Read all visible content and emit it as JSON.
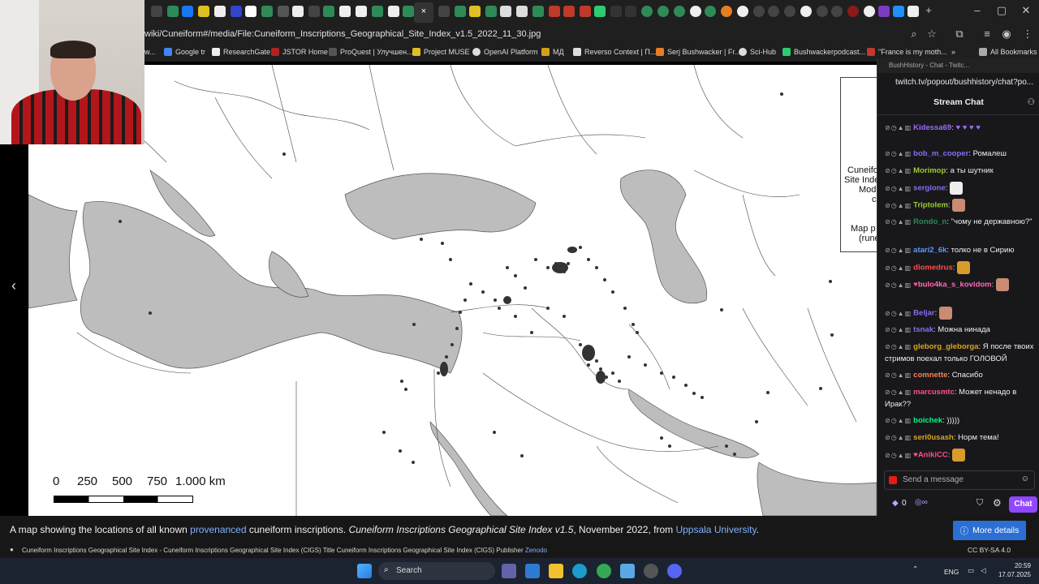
{
  "browser": {
    "url": "wiki/Cuneiform#/media/File:Cuneiform_Inscriptions_Geographical_Site_Index_v1.5_2022_11_30.jpg",
    "bookmarks": [
      "Google tr",
      "ResearchGate",
      "JSTOR Home",
      "ProQuest | Улучшен...",
      "Project MUSE",
      "OpenAI Platform",
      "МД",
      "Reverso Context | П...",
      "Serj Bushwacker | Fr...",
      "Sci-Hub",
      "Bushwackerpodcast...",
      "\"France is my moth...",
      "All Bookmarks"
    ],
    "bookmark_first_fragment": "w..."
  },
  "viewer": {
    "scale_labels": [
      "0",
      "250",
      "500",
      "750",
      "1.000 km"
    ],
    "legend_fragments": [
      "Cuneifo",
      "Site Inde",
      "Mod",
      "c",
      "Map p",
      "(rune"
    ]
  },
  "caption": {
    "prefix": "A map showing the locations of all known ",
    "link1": "provenanced",
    "mid": " cuneiform inscriptions. ",
    "title_italic": "Cuneiform Inscriptions Geographical Site Index v1.5",
    "date": ", November 2022, from ",
    "link2": "Uppsala University",
    "suffix": ".",
    "more_details": "More details",
    "footer": "Cuneiform Inscriptions Geographical Site Index - Cuneiform Inscriptions Geographical Site Index (CIGS) Title Cuneiform Inscriptions Geographical Site Index (CIGS) Publisher ",
    "footer_link": "Zenodo",
    "license": "CC BY-SA 4.0"
  },
  "chat": {
    "window_title": "BushHistory - Chat - Twitc...",
    "url": "twitch.tv/popout/bushhistory/chat?po...",
    "header": "Stream Chat",
    "input_placeholder": "Send a message",
    "points": "0",
    "send_button": "Chat",
    "messages": [
      {
        "user": "Kidessa69",
        "color": "#9b6bff",
        "text": ""
      },
      {
        "user": "bob_m_cooper",
        "color": "#8a6cf3",
        "text": "Ромалеш"
      },
      {
        "user": "Morimop",
        "color": "#9acd32",
        "text": "а ты шутник"
      },
      {
        "user": "sergione",
        "color": "#8a6cf3",
        "text": ""
      },
      {
        "user": "Triptolem",
        "color": "#9acd32",
        "text": ""
      },
      {
        "user": "Rondo_n",
        "color": "#2e8b57",
        "text": "\"чому не державною?\""
      },
      {
        "user": "atari2_6k",
        "color": "#5b9bff",
        "text": "толко не в Сирию"
      },
      {
        "user": "diomedrus",
        "color": "#ff4f4f",
        "text": ""
      },
      {
        "user": "bulo4ka_s_kovidom",
        "color": "#ff69b4",
        "text": ""
      },
      {
        "user": "Beljar",
        "color": "#8a6cf3",
        "text": ""
      },
      {
        "user": "tsnak",
        "color": "#8a6cf3",
        "text": "Можна нинада"
      },
      {
        "user": "gleborg_gleborga",
        "color": "#daa520",
        "text": "Я после твоих стримов поехал только ГОЛОВОЙ"
      },
      {
        "user": "comnette",
        "color": "#ff7f50",
        "text": "Спасибо"
      },
      {
        "user": "marcusmtc",
        "color": "#ff4f8b",
        "text": "Может ненадо в Ирак??"
      },
      {
        "user": "boichek",
        "color": "#00ff7f",
        "text": ")))))"
      },
      {
        "user": "seri0usash",
        "color": "#daa520",
        "text": "Норм тема!"
      },
      {
        "user": "AnikiCC",
        "color": "#ff4f8b",
        "text": ""
      }
    ]
  },
  "taskbar": {
    "search": "Search",
    "lang": "ENG",
    "time": "20:59",
    "date": "17.07.2025"
  }
}
